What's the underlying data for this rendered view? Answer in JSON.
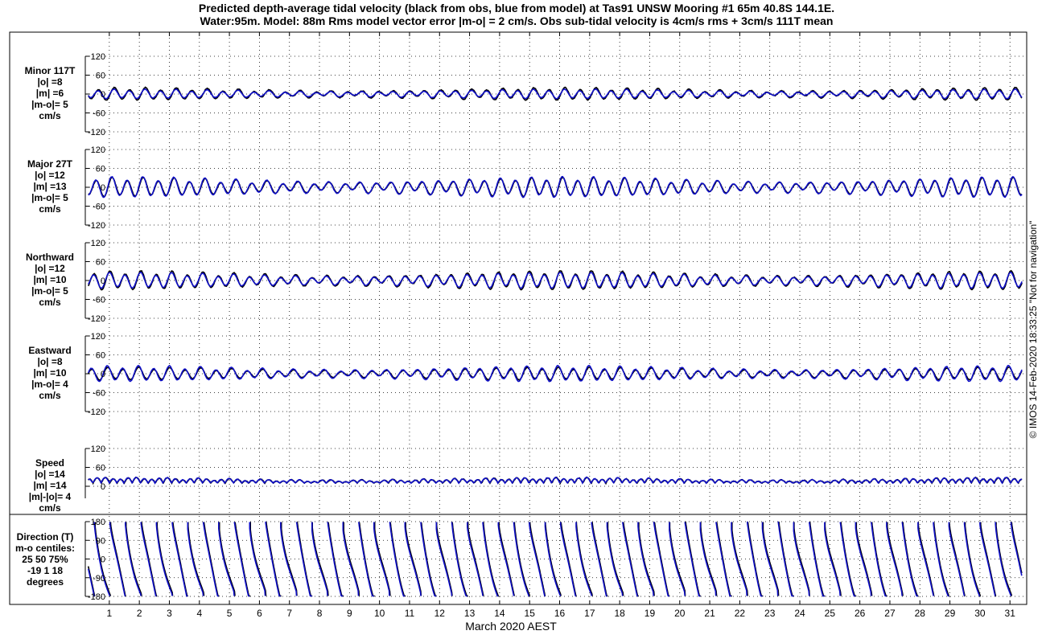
{
  "title": {
    "line1": "Predicted depth-average tidal velocity (black from obs, blue from model) at Tas91 UNSW Mooring #1 65m 40.8S 144.1E.",
    "line2": "Water:95m. Model: 88m  Rms model vector error |m-o| = 2 cm/s. Obs sub-tidal velocity is 4cm/s rms + 3cm/s 111T mean"
  },
  "copyright": "© IMOS 14-Feb-2020 18:33:25  \"Not for navigation\"",
  "colors": {
    "obs": "#000000",
    "model": "#1010c8",
    "grid": "#000000"
  },
  "chart_data": [
    {
      "type": "line",
      "panel": "minor",
      "labels": [
        "Minor 117T",
        "|o| =8",
        "|m| =6",
        "|m-o|= 5",
        "cm/s"
      ],
      "yticks": [
        "120",
        "60",
        "0",
        "-60",
        "-120"
      ],
      "ylim": [
        -120,
        120
      ],
      "grid": true,
      "amplitude": {
        "obs": 8,
        "model": 6
      },
      "series": [
        {
          "name": "obs"
        },
        {
          "name": "model"
        }
      ]
    },
    {
      "type": "line",
      "panel": "major",
      "labels": [
        "Major 27T",
        "|o| =12",
        "|m| =13",
        "|m-o|= 5",
        "cm/s"
      ],
      "yticks": [
        "120",
        "60",
        "0",
        "-60",
        "-120"
      ],
      "ylim": [
        -120,
        120
      ],
      "grid": true,
      "amplitude": {
        "obs": 12,
        "model": 13
      },
      "series": [
        {
          "name": "obs"
        },
        {
          "name": "model"
        }
      ]
    },
    {
      "type": "line",
      "panel": "north",
      "labels": [
        "Northward",
        "|o| =12",
        "|m| =10",
        "|m-o|= 5",
        "cm/s"
      ],
      "yticks": [
        "120",
        "60",
        "0",
        "-60",
        "-120"
      ],
      "ylim": [
        -120,
        120
      ],
      "grid": true,
      "amplitude": {
        "obs": 12,
        "model": 10
      },
      "series": [
        {
          "name": "obs"
        },
        {
          "name": "model"
        }
      ]
    },
    {
      "type": "line",
      "panel": "east",
      "labels": [
        "Eastward",
        "|o| =8",
        "|m| =10",
        "|m-o|= 4",
        "cm/s"
      ],
      "yticks": [
        "120",
        "60",
        "0",
        "-60",
        "-120"
      ],
      "ylim": [
        -120,
        120
      ],
      "grid": true,
      "amplitude": {
        "obs": 8,
        "model": 10
      },
      "series": [
        {
          "name": "obs"
        },
        {
          "name": "model"
        }
      ]
    },
    {
      "type": "line",
      "panel": "speed",
      "labels": [
        "Speed",
        "|o| =14",
        "|m| =14",
        "|m|-|o|= 4",
        "cm/s"
      ],
      "yticks": [
        "120",
        "60",
        "0"
      ],
      "ylim": [
        -20,
        120
      ],
      "grid": true,
      "amplitude": {
        "obs": 14,
        "model": 14
      },
      "series": [
        {
          "name": "obs"
        },
        {
          "name": "model"
        }
      ]
    },
    {
      "type": "line",
      "panel": "direction",
      "labels": [
        "Direction (T)",
        "m-o centiles:",
        "25  50  75%",
        "-19   1  18",
        "degrees"
      ],
      "yticks": [
        "180",
        "90",
        "0",
        "-90",
        "-180"
      ],
      "ylim": [
        -180,
        180
      ],
      "grid": true,
      "series": [
        {
          "name": "obs"
        },
        {
          "name": "model"
        }
      ]
    }
  ],
  "x_axis": {
    "label": "March 2020 AEST",
    "ticks": [
      "1",
      "2",
      "3",
      "4",
      "5",
      "6",
      "7",
      "8",
      "9",
      "10",
      "11",
      "12",
      "13",
      "14",
      "15",
      "16",
      "17",
      "18",
      "19",
      "20",
      "21",
      "22",
      "23",
      "24",
      "25",
      "26",
      "27",
      "28",
      "29",
      "30",
      "31"
    ],
    "xlim_days": [
      0.2,
      31.45
    ]
  }
}
